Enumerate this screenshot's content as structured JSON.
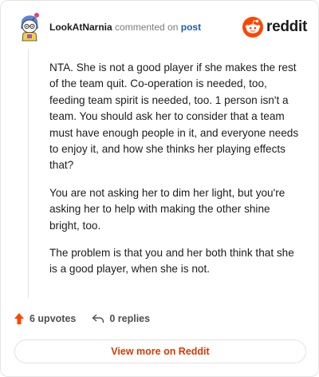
{
  "header": {
    "username": "LookAtNarnia",
    "action_text": "commented on",
    "post_link": "post",
    "brand": "reddit",
    "avatar_icon": "snoo-avatar-icon",
    "logo_icon": "reddit-snoo-logo-icon"
  },
  "comment": {
    "paragraphs": [
      "NTA. She is not a good player if she makes the rest of the team quit. Co-operation is needed, too, feeding team spirit is needed, too. 1 person isn't a team. You should ask her to consider that a team must have enough people in it, and everyone needs to enjoy it, and how she thinks her playing effects that?",
      "You are not asking her to dim her light, but you're asking her to help with making the other shine bright, too.",
      "The problem is that you and her both think that she is a good player, when she is not."
    ]
  },
  "footer": {
    "upvotes": "6 upvotes",
    "replies": "0 replies",
    "upvote_icon": "upvote-arrow-icon",
    "reply_icon": "reply-arrow-icon"
  },
  "cta": {
    "label": "View more on Reddit"
  },
  "colors": {
    "brand": "#ff4500",
    "link": "#1a5fb4",
    "cta_text": "#d93a00"
  }
}
